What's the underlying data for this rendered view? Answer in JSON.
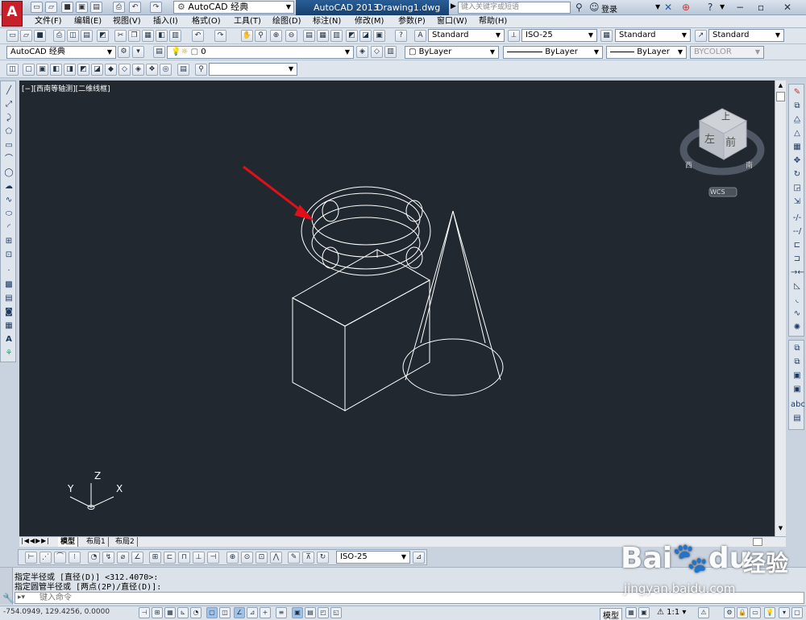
{
  "app": {
    "logo_letter": "A",
    "workspace": "AutoCAD 经典",
    "product": "AutoCAD 2013",
    "filename": "Drawing1.dwg",
    "search_placeholder": "键入关键字或短语",
    "login": "登录",
    "help": "?"
  },
  "menu": [
    "文件(F)",
    "编辑(E)",
    "视图(V)",
    "插入(I)",
    "格式(O)",
    "工具(T)",
    "绘图(D)",
    "标注(N)",
    "修改(M)",
    "参数(P)",
    "窗口(W)",
    "帮助(H)"
  ],
  "styles": {
    "text_style": "Standard",
    "dim_style": "ISO-25",
    "table_style": "Standard",
    "multileader_style": "Standard"
  },
  "layers": {
    "workspace2": "AutoCAD 经典",
    "current_layer": "0",
    "color": "ByLayer",
    "linetype": "ByLayer",
    "lineweight": "ByLayer",
    "plotstyle": "BYCOLOR"
  },
  "viewport": {
    "label": "[−][西南等轴测][二维线框]",
    "viewcube_top": "上",
    "viewcube_left": "左",
    "viewcube_front": "前",
    "compass_w": "西",
    "compass_s": "南",
    "wcs": "WCS",
    "ucs_x": "X",
    "ucs_y": "Y",
    "ucs_z": "Z"
  },
  "layout_tabs": [
    "模型",
    "布局1",
    "布局2"
  ],
  "dim_toolbar": {
    "dim_style": "ISO-25"
  },
  "command": {
    "history_1": "指定半径或 [直径(D)] <312.4070>:",
    "history_2": "指定圆管半径或 [两点(2P)/直径(D)]:",
    "input_placeholder": "键入命令"
  },
  "status": {
    "coords": "-754.0949, 129.4256, 0.0000",
    "model": "模型",
    "scale": "1:1"
  },
  "watermark": {
    "brand": "Bai",
    "brand2": "du",
    "label": "经验",
    "url": "jingyan.baidu.com"
  },
  "colors": {
    "drawing_bg": "#212830",
    "wireframe": "#ffffff",
    "arrow": "#e0101a",
    "title_active": "#1f4f86"
  }
}
